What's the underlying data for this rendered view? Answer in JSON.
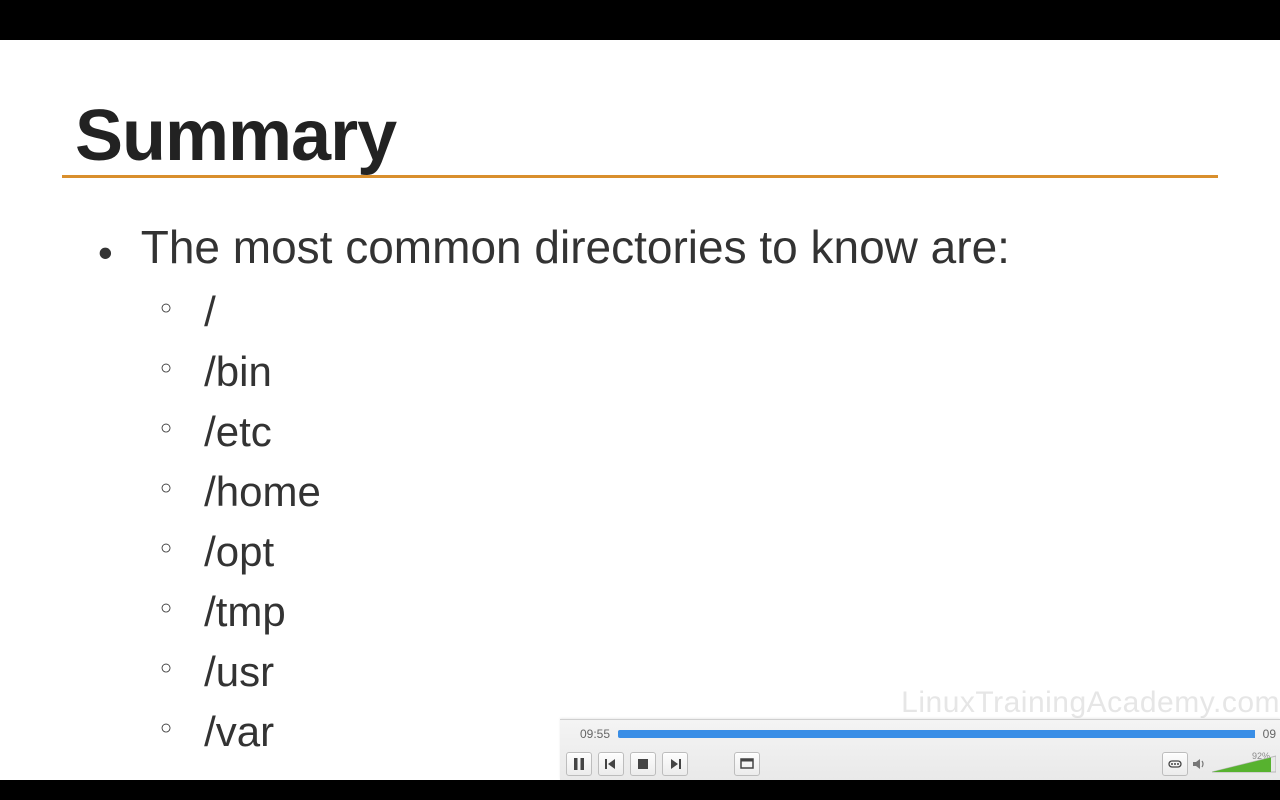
{
  "slide": {
    "title": "Summary",
    "main_bullet": "The most common directories to know are:",
    "sub_items": [
      "/",
      "/bin",
      "/etc",
      "/home",
      "/opt",
      "/tmp",
      "/usr",
      "/var"
    ],
    "watermark": "LinuxTrainingAcademy.com"
  },
  "player": {
    "current_time": "09:55",
    "total_time": "09",
    "progress_pct": 100,
    "volume_pct_label": "92%",
    "volume_fill_pct": 92
  },
  "colors": {
    "accent_rule": "#d98f2d",
    "progress": "#3a8ee6",
    "volume_fill": "#57b22f"
  }
}
